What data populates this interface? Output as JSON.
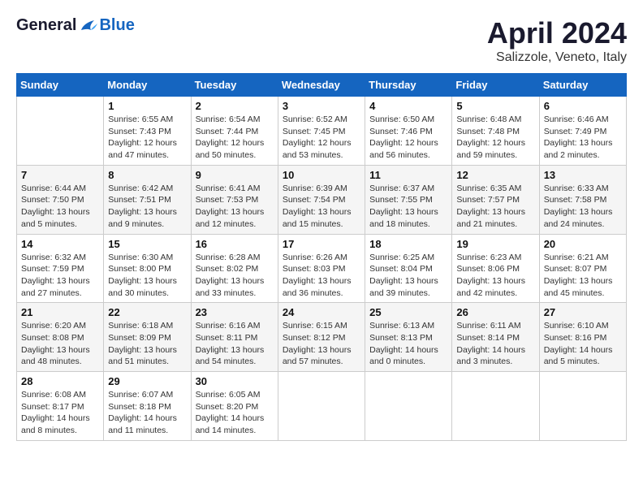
{
  "header": {
    "logo": {
      "general": "General",
      "blue": "Blue"
    },
    "title": "April 2024",
    "location": "Salizzole, Veneto, Italy"
  },
  "calendar": {
    "days_of_week": [
      "Sunday",
      "Monday",
      "Tuesday",
      "Wednesday",
      "Thursday",
      "Friday",
      "Saturday"
    ],
    "weeks": [
      [
        {
          "day": "",
          "info": ""
        },
        {
          "day": "1",
          "info": "Sunrise: 6:55 AM\nSunset: 7:43 PM\nDaylight: 12 hours\nand 47 minutes."
        },
        {
          "day": "2",
          "info": "Sunrise: 6:54 AM\nSunset: 7:44 PM\nDaylight: 12 hours\nand 50 minutes."
        },
        {
          "day": "3",
          "info": "Sunrise: 6:52 AM\nSunset: 7:45 PM\nDaylight: 12 hours\nand 53 minutes."
        },
        {
          "day": "4",
          "info": "Sunrise: 6:50 AM\nSunset: 7:46 PM\nDaylight: 12 hours\nand 56 minutes."
        },
        {
          "day": "5",
          "info": "Sunrise: 6:48 AM\nSunset: 7:48 PM\nDaylight: 12 hours\nand 59 minutes."
        },
        {
          "day": "6",
          "info": "Sunrise: 6:46 AM\nSunset: 7:49 PM\nDaylight: 13 hours\nand 2 minutes."
        }
      ],
      [
        {
          "day": "7",
          "info": "Sunrise: 6:44 AM\nSunset: 7:50 PM\nDaylight: 13 hours\nand 5 minutes."
        },
        {
          "day": "8",
          "info": "Sunrise: 6:42 AM\nSunset: 7:51 PM\nDaylight: 13 hours\nand 9 minutes."
        },
        {
          "day": "9",
          "info": "Sunrise: 6:41 AM\nSunset: 7:53 PM\nDaylight: 13 hours\nand 12 minutes."
        },
        {
          "day": "10",
          "info": "Sunrise: 6:39 AM\nSunset: 7:54 PM\nDaylight: 13 hours\nand 15 minutes."
        },
        {
          "day": "11",
          "info": "Sunrise: 6:37 AM\nSunset: 7:55 PM\nDaylight: 13 hours\nand 18 minutes."
        },
        {
          "day": "12",
          "info": "Sunrise: 6:35 AM\nSunset: 7:57 PM\nDaylight: 13 hours\nand 21 minutes."
        },
        {
          "day": "13",
          "info": "Sunrise: 6:33 AM\nSunset: 7:58 PM\nDaylight: 13 hours\nand 24 minutes."
        }
      ],
      [
        {
          "day": "14",
          "info": "Sunrise: 6:32 AM\nSunset: 7:59 PM\nDaylight: 13 hours\nand 27 minutes."
        },
        {
          "day": "15",
          "info": "Sunrise: 6:30 AM\nSunset: 8:00 PM\nDaylight: 13 hours\nand 30 minutes."
        },
        {
          "day": "16",
          "info": "Sunrise: 6:28 AM\nSunset: 8:02 PM\nDaylight: 13 hours\nand 33 minutes."
        },
        {
          "day": "17",
          "info": "Sunrise: 6:26 AM\nSunset: 8:03 PM\nDaylight: 13 hours\nand 36 minutes."
        },
        {
          "day": "18",
          "info": "Sunrise: 6:25 AM\nSunset: 8:04 PM\nDaylight: 13 hours\nand 39 minutes."
        },
        {
          "day": "19",
          "info": "Sunrise: 6:23 AM\nSunset: 8:06 PM\nDaylight: 13 hours\nand 42 minutes."
        },
        {
          "day": "20",
          "info": "Sunrise: 6:21 AM\nSunset: 8:07 PM\nDaylight: 13 hours\nand 45 minutes."
        }
      ],
      [
        {
          "day": "21",
          "info": "Sunrise: 6:20 AM\nSunset: 8:08 PM\nDaylight: 13 hours\nand 48 minutes."
        },
        {
          "day": "22",
          "info": "Sunrise: 6:18 AM\nSunset: 8:09 PM\nDaylight: 13 hours\nand 51 minutes."
        },
        {
          "day": "23",
          "info": "Sunrise: 6:16 AM\nSunset: 8:11 PM\nDaylight: 13 hours\nand 54 minutes."
        },
        {
          "day": "24",
          "info": "Sunrise: 6:15 AM\nSunset: 8:12 PM\nDaylight: 13 hours\nand 57 minutes."
        },
        {
          "day": "25",
          "info": "Sunrise: 6:13 AM\nSunset: 8:13 PM\nDaylight: 14 hours\nand 0 minutes."
        },
        {
          "day": "26",
          "info": "Sunrise: 6:11 AM\nSunset: 8:14 PM\nDaylight: 14 hours\nand 3 minutes."
        },
        {
          "day": "27",
          "info": "Sunrise: 6:10 AM\nSunset: 8:16 PM\nDaylight: 14 hours\nand 5 minutes."
        }
      ],
      [
        {
          "day": "28",
          "info": "Sunrise: 6:08 AM\nSunset: 8:17 PM\nDaylight: 14 hours\nand 8 minutes."
        },
        {
          "day": "29",
          "info": "Sunrise: 6:07 AM\nSunset: 8:18 PM\nDaylight: 14 hours\nand 11 minutes."
        },
        {
          "day": "30",
          "info": "Sunrise: 6:05 AM\nSunset: 8:20 PM\nDaylight: 14 hours\nand 14 minutes."
        },
        {
          "day": "",
          "info": ""
        },
        {
          "day": "",
          "info": ""
        },
        {
          "day": "",
          "info": ""
        },
        {
          "day": "",
          "info": ""
        }
      ]
    ]
  }
}
